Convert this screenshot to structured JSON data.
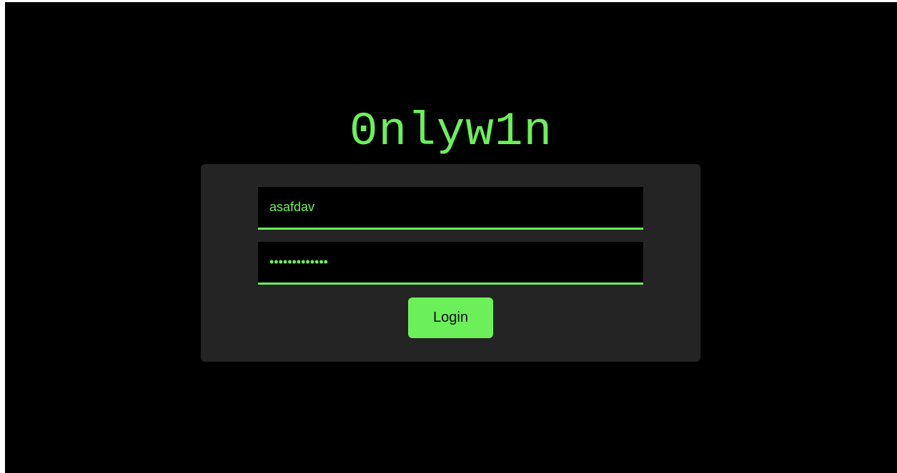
{
  "app": {
    "logo_text": "0nlyw1n"
  },
  "login_form": {
    "username_value": "asafdav",
    "password_value": "•••••••••••••",
    "login_label": "Login"
  },
  "colors": {
    "page_background": "#000000",
    "card_background": "#242424",
    "accent_green": "#6cf05a",
    "button_text": "#0a0a0a"
  }
}
